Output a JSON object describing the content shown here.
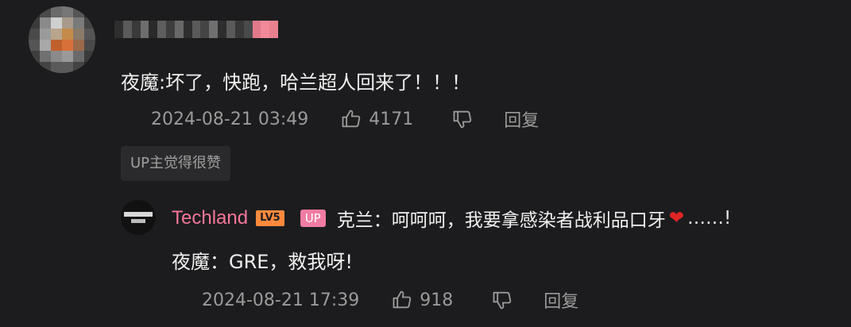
{
  "comment": {
    "text": "夜魔:坏了，快跑，哈兰超人回来了！！！",
    "timestamp": "2024-08-21 03:49",
    "like_count": "4171",
    "reply_label": "回复",
    "up_liked_label": "UP主觉得很赞"
  },
  "reply": {
    "username": "Techland",
    "level": "LV5",
    "up_badge": "UP",
    "text_line1": "克兰：呵呵呵，我要拿感染者战利品口牙",
    "heart": "❤",
    "text_line1_end": "……!",
    "text_line2": "夜魔：GRE，救我呀!",
    "timestamp": "2024-08-21 17:39",
    "like_count": "918",
    "reply_label": "回复"
  },
  "colors": {
    "background": "#1c1c1e",
    "username_pink": "#f4779a",
    "level_orange": "#ff8a3d",
    "up_badge_pink": "#f07ca3",
    "muted_text": "#9a9a9a"
  },
  "icons": [
    "like-icon",
    "dislike-icon"
  ]
}
